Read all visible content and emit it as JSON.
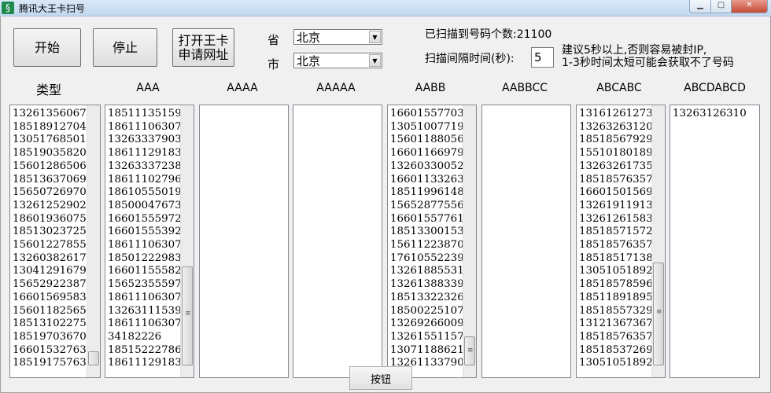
{
  "window": {
    "title": "腾讯大王卡扫号",
    "app_icon": "app-logo-icon"
  },
  "controls": {
    "start": "开始",
    "stop": "停止",
    "open_url": "打开王卡\n申请网址",
    "province_label": "省",
    "province_value": "北京",
    "city_label": "市",
    "city_value": "北京",
    "scanned_text": "已扫描到号码个数:21100",
    "interval_label": "扫描间隔时间(秒):",
    "interval_value": "5",
    "hint": "建议5秒以上,否则容易被封IP,\n1-3秒时间太短可能会获取不了号码",
    "bottom_button": "按钮"
  },
  "columns": [
    {
      "header": "类型",
      "items": [
        "13261356067",
        "18518912704",
        "13051768501",
        "18519035820",
        "15601286506",
        "18513637069",
        "15650726970",
        "13261252902",
        "18601936075",
        "18513023725",
        "15601227855",
        "13260382617",
        "13041291679",
        "15652922387",
        "16601569583",
        "15601182565",
        "18513102275",
        "18519703670",
        "16601532763",
        "18519175763"
      ]
    },
    {
      "header": "AAA",
      "items": [
        "18511135159",
        "18611106307",
        "13263337903",
        "18611129183",
        "13263337238",
        "18611102796",
        "18610555019",
        "18500047673",
        "16601555972",
        "16601555392",
        "18611106307",
        "18501222983",
        "16601155582",
        "15652355597",
        "18611106307",
        "13263111539",
        "18611106307",
        "34182226",
        "18515222786",
        "18611129183"
      ]
    },
    {
      "header": "AAAA",
      "items": []
    },
    {
      "header": "AAAAA",
      "items": []
    },
    {
      "header": "AABB",
      "items": [
        "16601557703",
        "13051007719",
        "15601188056",
        "16601166979",
        "13260330052",
        "16601133263",
        "18511996148",
        "15652877556",
        "16601557761",
        "18513300153",
        "15611223870",
        "17610552239",
        "13261885531",
        "13261388339",
        "18513322326",
        "18500225107",
        "13269266009",
        "13261551157",
        "13071188621",
        "13261133790"
      ]
    },
    {
      "header": "AABBCC",
      "items": []
    },
    {
      "header": "ABCABC",
      "items": [
        "13161261273",
        "13263263120",
        "18518567929",
        "15510180189",
        "13263261735",
        "18518576357",
        "16601501569",
        "13261911913",
        "13261261583",
        "18518571572",
        "18518576357",
        "18518517138",
        "13051051892",
        "18518578596",
        "18511891895",
        "18518557329",
        "13121367367",
        "18518576357",
        "18518537269",
        "13051051892"
      ]
    },
    {
      "header": "ABCDABCD",
      "items": [
        "13263126310"
      ]
    }
  ]
}
